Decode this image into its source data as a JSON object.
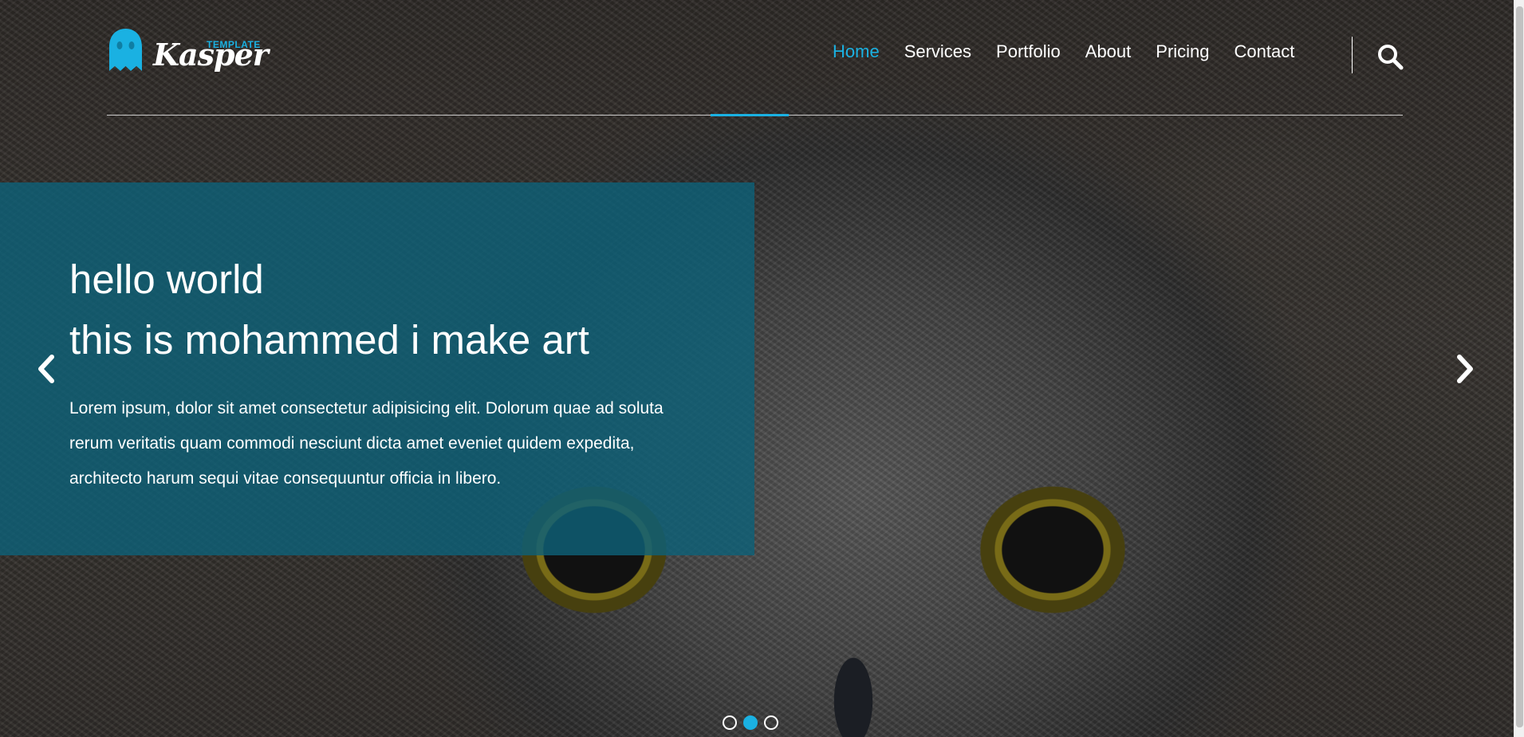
{
  "logo": {
    "small": "TEMPLATE",
    "main": "Kasper"
  },
  "nav": {
    "items": [
      {
        "label": "Home",
        "active": true
      },
      {
        "label": "Services"
      },
      {
        "label": "Portfolio"
      },
      {
        "label": "About"
      },
      {
        "label": "Pricing"
      },
      {
        "label": "Contact"
      }
    ],
    "search_icon": "search-icon"
  },
  "slide": {
    "title_line1": "hello world",
    "title_line2": "this is mohammed i make art",
    "text": "Lorem ipsum, dolor sit amet consectetur adipisicing elit. Dolorum quae ad soluta rerum veritatis quam commodi nesciunt dicta amet eveniet quidem expedita, architecto harum sequi vitae consequuntur officia in libero.",
    "current": 2,
    "total": 3
  },
  "colors": {
    "accent": "#1ab1e2",
    "slide_box": "#0d6077"
  },
  "icons": {
    "prev": "chevron-left-icon",
    "next": "chevron-right-icon",
    "logo": "ghost-icon"
  }
}
